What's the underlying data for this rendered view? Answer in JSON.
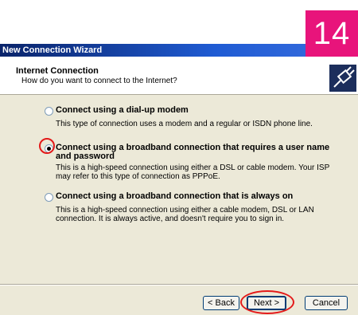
{
  "step_badge": "14",
  "window": {
    "title": "New Connection Wizard"
  },
  "header": {
    "title": "Internet Connection",
    "subtitle": "How do you want to connect to the Internet?",
    "icon": "network-plug-icon"
  },
  "options": [
    {
      "label": "Connect using a dial-up modem",
      "description": "This type of connection uses a modem and a regular or ISDN phone line.",
      "selected": false
    },
    {
      "label": "Connect using a broadband connection that requires a user name and password",
      "description": "This is a high-speed connection using either a DSL or cable modem. Your ISP may refer to this type of connection as PPPoE.",
      "selected": true
    },
    {
      "label": "Connect using a broadband connection that is always on",
      "description": "This is a high-speed connection using either a cable modem, DSL or LAN connection. It is always active, and doesn't require you to sign in.",
      "selected": false
    }
  ],
  "buttons": {
    "back": "< Back",
    "next": "Next >",
    "cancel": "Cancel"
  },
  "colors": {
    "badge": "#e8147b",
    "highlight": "#e31a1a",
    "titlebar": "#0a246a"
  }
}
